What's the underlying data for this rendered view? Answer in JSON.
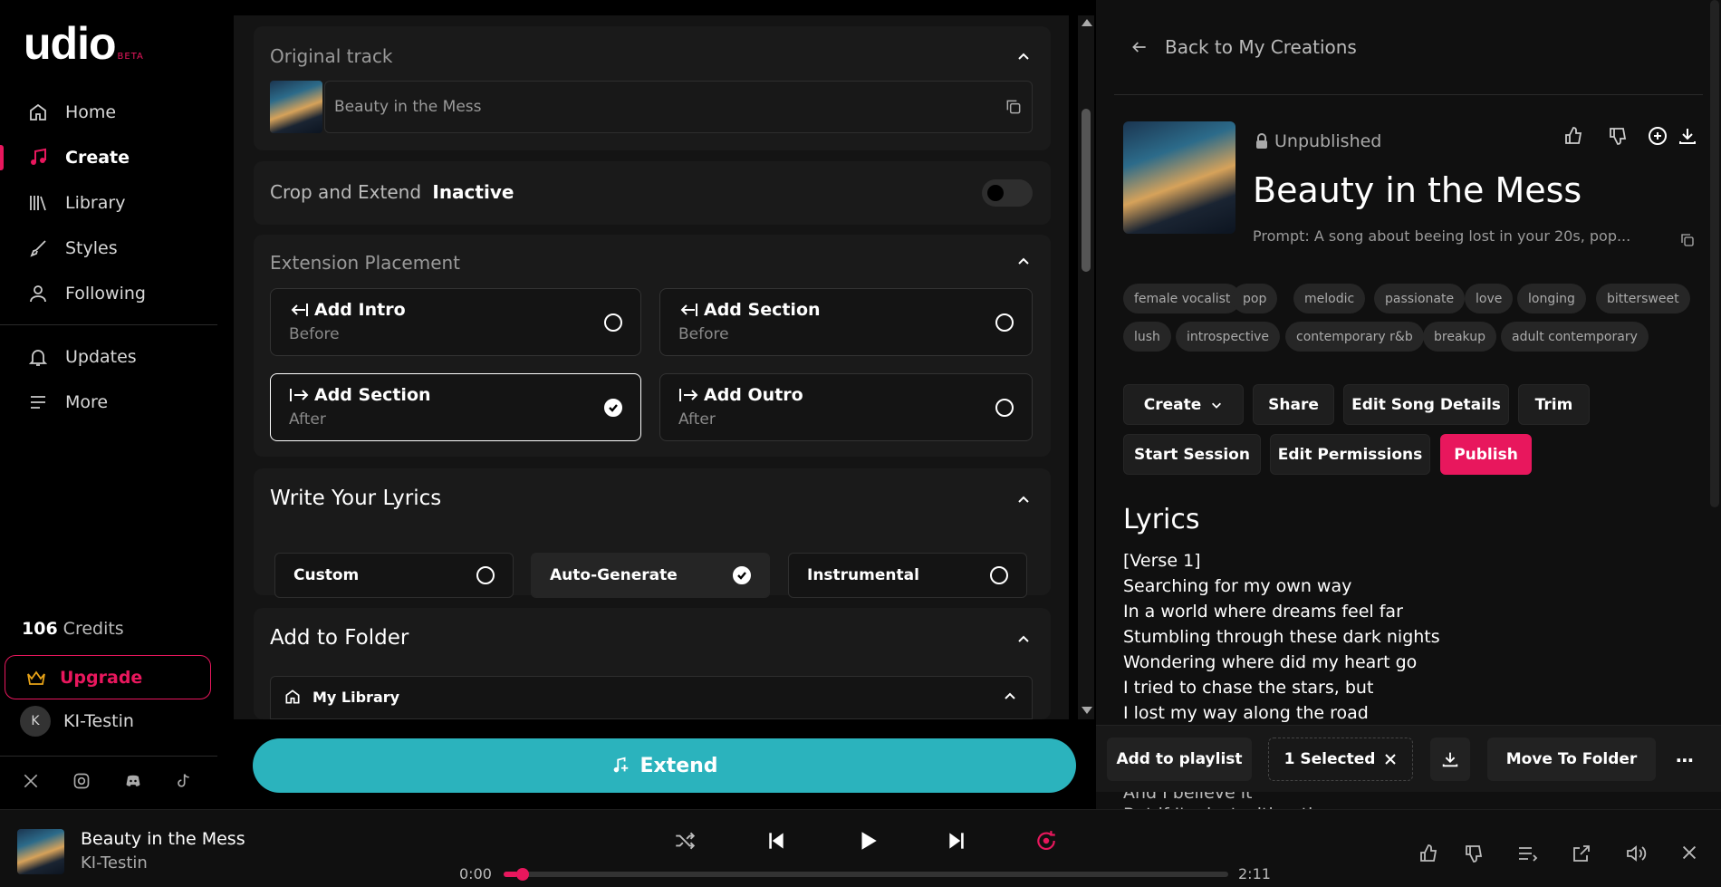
{
  "sidebar": {
    "logo": "udio",
    "beta": "BETA",
    "nav": [
      {
        "label": "Home",
        "icon": "home-icon"
      },
      {
        "label": "Create",
        "icon": "music-note-icon"
      },
      {
        "label": "Library",
        "icon": "library-icon"
      },
      {
        "label": "Styles",
        "icon": "brush-icon"
      },
      {
        "label": "Following",
        "icon": "user-icon"
      },
      {
        "label": "Updates",
        "icon": "bell-icon"
      },
      {
        "label": "More",
        "icon": "menu-icon"
      }
    ],
    "credits_count": "106",
    "credits_label": "Credits",
    "upgrade": "Upgrade",
    "user_initial": "K",
    "user_name": "KI-Testin",
    "social": [
      "x-icon",
      "instagram-icon",
      "discord-icon",
      "tiktok-icon"
    ]
  },
  "center": {
    "original_track": {
      "title": "Original track",
      "track": "Beauty in the Mess"
    },
    "crop": {
      "label": "Crop and Extend",
      "state": "Inactive"
    },
    "placement": {
      "title": "Extension Placement",
      "options": [
        {
          "label": "Add Intro",
          "sub": "Before",
          "selected": false
        },
        {
          "label": "Add Section",
          "sub": "Before",
          "selected": false
        },
        {
          "label": "Add Section",
          "sub": "After",
          "selected": true
        },
        {
          "label": "Add Outro",
          "sub": "After",
          "selected": false
        }
      ]
    },
    "lyrics": {
      "title": "Write Your Lyrics",
      "options": [
        {
          "label": "Custom",
          "selected": false
        },
        {
          "label": "Auto-Generate",
          "selected": true
        },
        {
          "label": "Instrumental",
          "selected": false
        }
      ]
    },
    "folder": {
      "title": "Add to Folder",
      "item": "My Library"
    },
    "extend_label": "Extend"
  },
  "right": {
    "back": "Back to My Creations",
    "status": "Unpublished",
    "title": "Beauty in the Mess",
    "prompt": "Prompt: A song about beeing lost in your 20s, pop...",
    "tags": [
      "female vocalist",
      "pop",
      "melodic",
      "passionate",
      "love",
      "longing",
      "bittersweet",
      "lush",
      "introspective",
      "contemporary r&b",
      "breakup",
      "adult contemporary"
    ],
    "buttons": {
      "create": "Create",
      "share": "Share",
      "edit_details": "Edit Song Details",
      "trim": "Trim",
      "start_session": "Start Session",
      "edit_permissions": "Edit Permissions",
      "publish": "Publish"
    },
    "lyrics_title": "Lyrics",
    "lyrics": [
      "[Verse 1]",
      "Searching for my own way",
      "In a world where dreams feel far",
      "Stumbling through these dark nights",
      "Wondering where did my heart go",
      "I tried to chase the stars, but",
      "I lost my way along the road"
    ],
    "lyrics_cut": [
      "And I believe it",
      "But if I'm lost with... the..."
    ]
  },
  "selection_bar": {
    "add_playlist": "Add to playlist",
    "selected": "1 Selected",
    "move_folder": "Move To Folder"
  },
  "player": {
    "title": "Beauty in the Mess",
    "artist": "KI-Testin",
    "current": "0:00",
    "duration": "2:11",
    "progress": 0.02
  },
  "colors": {
    "accent": "#e8175d",
    "extend": "#2bb3bd"
  }
}
